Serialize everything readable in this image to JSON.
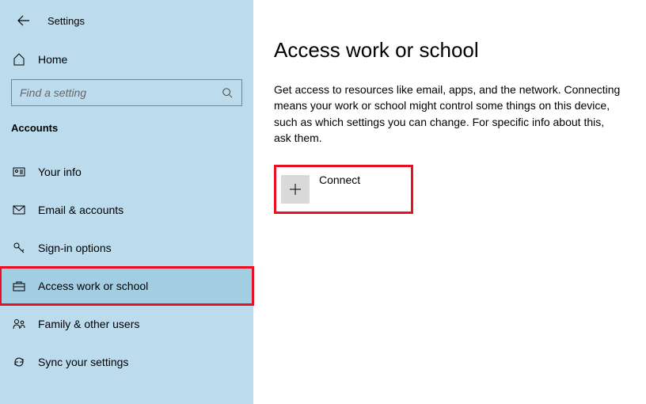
{
  "header": {
    "title": "Settings"
  },
  "home": {
    "label": "Home"
  },
  "search": {
    "placeholder": "Find a setting"
  },
  "section": {
    "title": "Accounts"
  },
  "nav": {
    "items": [
      {
        "label": "Your info"
      },
      {
        "label": "Email & accounts"
      },
      {
        "label": "Sign-in options"
      },
      {
        "label": "Access work or school"
      },
      {
        "label": "Family & other users"
      },
      {
        "label": "Sync your settings"
      }
    ]
  },
  "page": {
    "title": "Access work or school",
    "description": "Get access to resources like email, apps, and the network. Connecting means your work or school might control some things on this device, such as which settings you can change. For specific info about this, ask them."
  },
  "connect": {
    "label": "Connect"
  }
}
